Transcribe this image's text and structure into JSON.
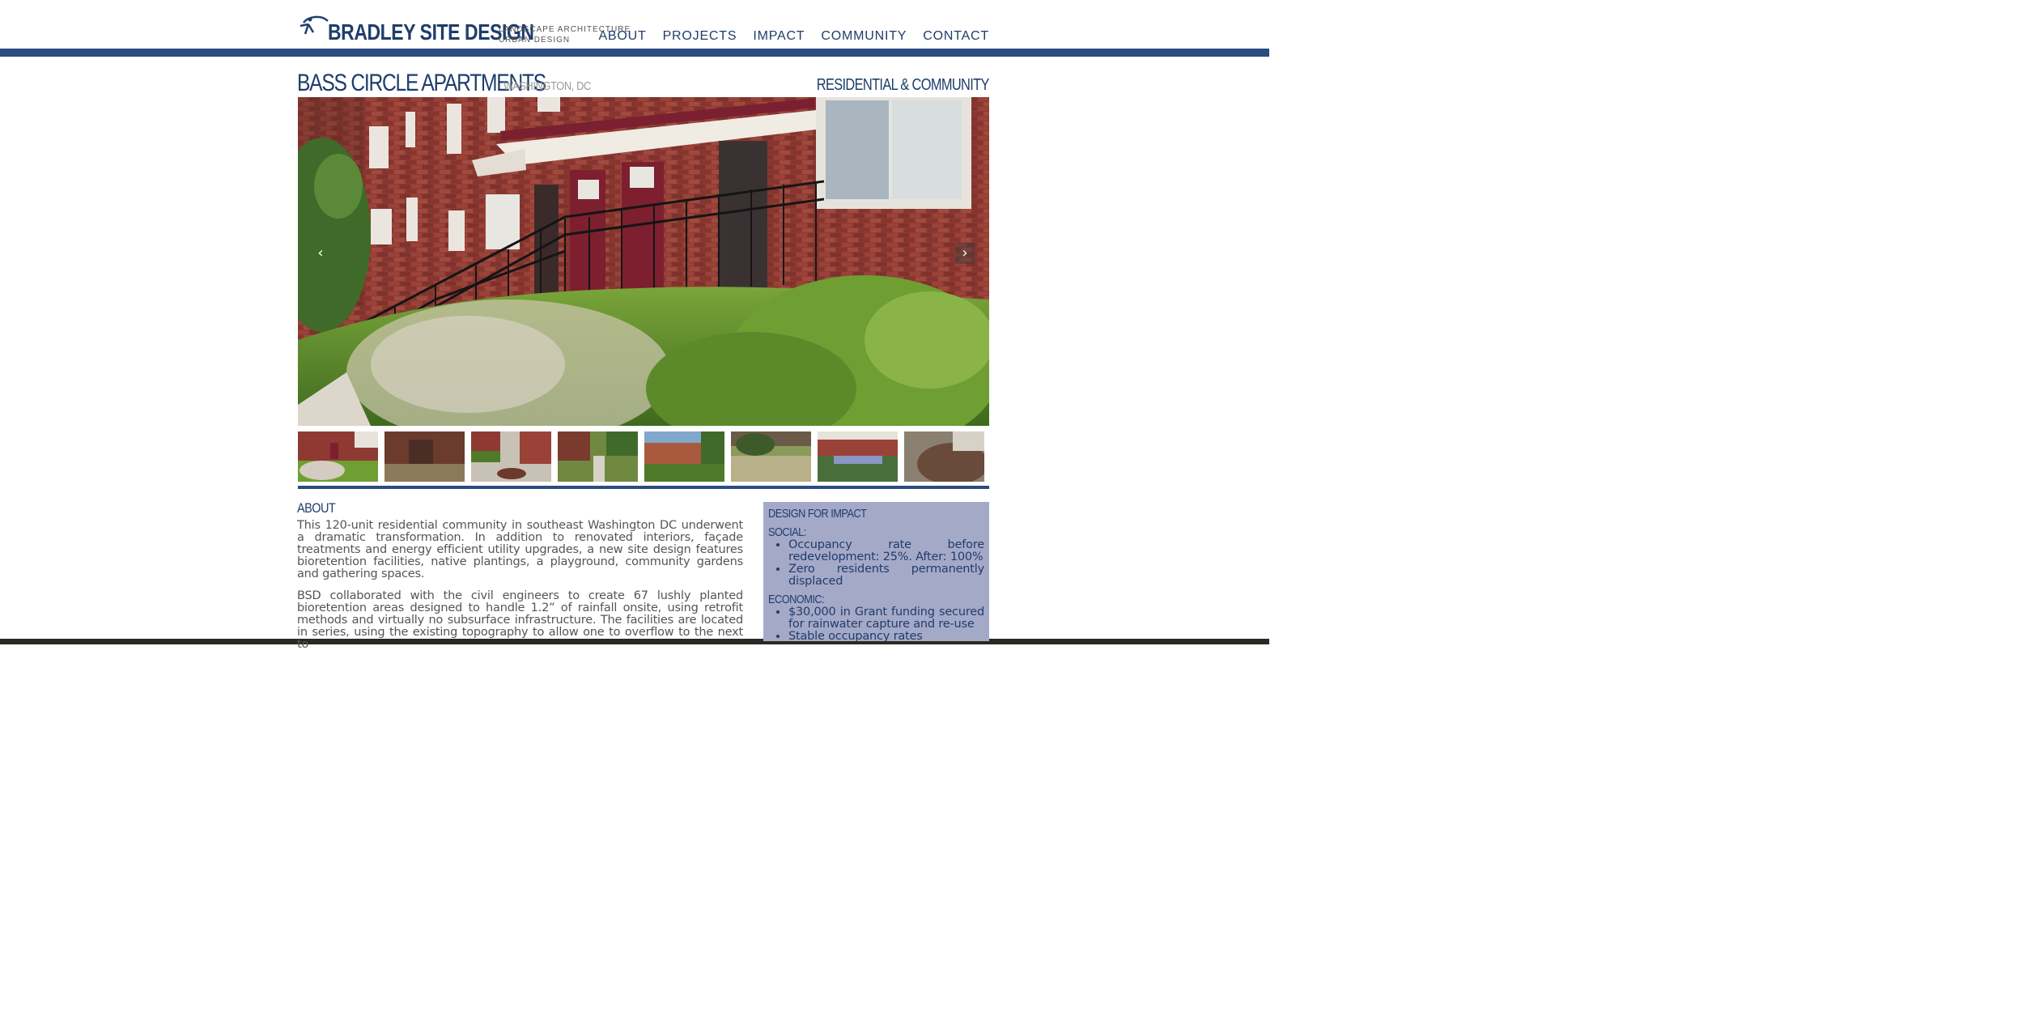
{
  "header": {
    "brand": "BRADLEY SITE DESIGN",
    "tagline_line1": "LANDSCAPE ARCHITECTURE",
    "tagline_line2": "URBAN DESIGN",
    "nav": [
      "ABOUT",
      "PROJECTS",
      "IMPACT",
      "COMMUNITY",
      "CONTACT"
    ]
  },
  "project": {
    "title": "BASS CIRCLE APARTMENTS",
    "location": "WASHINGTON, DC",
    "category": "RESIDENTIAL & COMMUNITY"
  },
  "slider": {
    "prev_icon": "chevron-left-icon",
    "next_icon": "chevron-right-icon",
    "thumbnail_count": 8
  },
  "about": {
    "heading": "ABOUT",
    "paragraphs": [
      "This 120-unit residential community in southeast Washington DC underwent a dramatic transformation. In addition to renovated interiors, façade treatments and energy efficient utility upgrades, a new site design features bioretention facilities, native plantings, a playground, community gardens and gathering spaces.",
      "BSD collaborated with the civil engineers to create 67 lushly planted bioretention areas designed to handle 1.2” of rainfall onsite, using retrofit methods and virtually no subsurface infrastructure. The facilities are located in series, using the existing topography to allow one to overflow to the next to"
    ]
  },
  "impact": {
    "heading": "DESIGN FOR IMPACT",
    "social_heading": "SOCIAL:",
    "social_items": [
      "Occupancy rate before redevelopment: 25%. After: 100%",
      "Zero residents permanently displaced"
    ],
    "economic_heading": "ECONOMIC:",
    "economic_items": [
      "$30,000 in Grant funding secured for rainwater capture and re-use",
      "Stable occupancy rates"
    ]
  },
  "colors": {
    "brand_blue": "#1f3d6b",
    "bar_blue": "#2b4c80",
    "impact_bg": "#a5a9c8",
    "body_text": "#555555"
  }
}
